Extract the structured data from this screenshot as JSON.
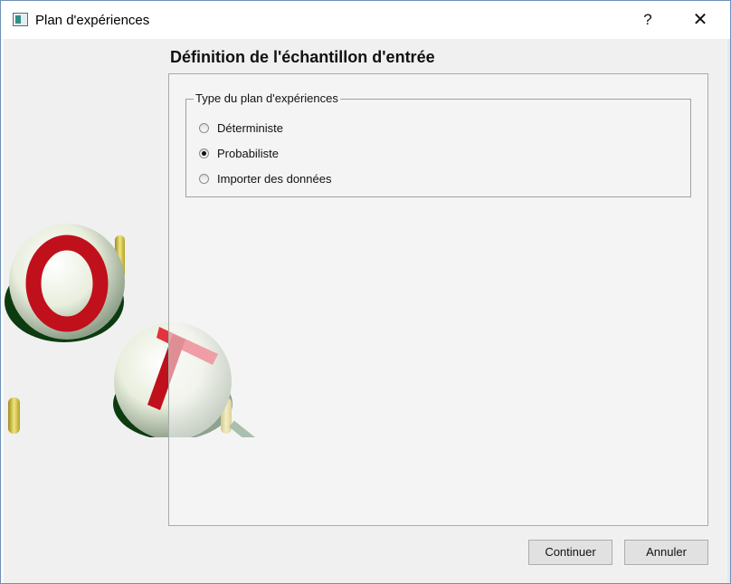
{
  "window": {
    "title": "Plan d'expériences",
    "help_symbol": "?",
    "close_symbol": "✕",
    "icon": "app-window-icon"
  },
  "page": {
    "title": "Définition de l'échantillon d'entrée"
  },
  "group": {
    "legend": "Type du plan d'expériences",
    "options": [
      {
        "label": "Déterministe",
        "checked": false
      },
      {
        "label": "Probabiliste",
        "checked": true
      },
      {
        "label": "Importer des données",
        "checked": false
      }
    ]
  },
  "buttons": {
    "continue_label": "Continuer",
    "cancel_label": "Annuler"
  },
  "decor": {
    "logo": "openturns-logo",
    "logo_letters": [
      "O",
      "T"
    ]
  }
}
